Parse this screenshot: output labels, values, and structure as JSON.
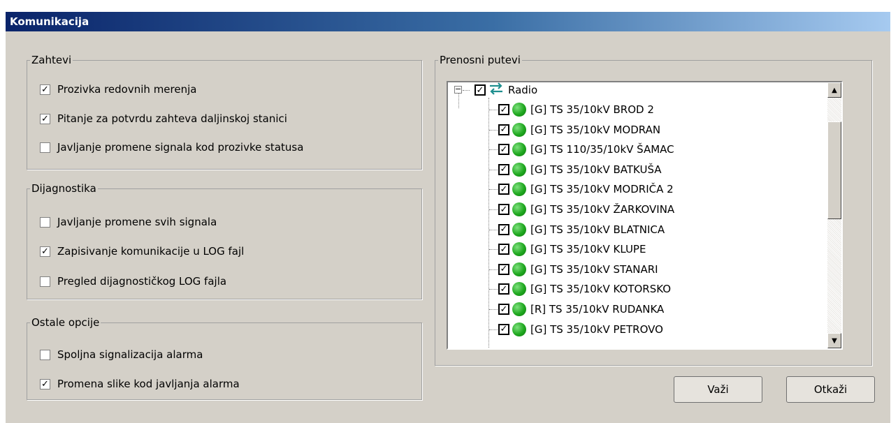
{
  "window": {
    "title": "Komunikacija"
  },
  "groups": {
    "zahtevi": {
      "legend": "Zahtevi",
      "items": [
        {
          "label": "Prozivka redovnih merenja",
          "checked": true
        },
        {
          "label": "Pitanje za potvrdu zahteva daljinskoj stanici",
          "checked": true
        },
        {
          "label": "Javljanje promene signala kod prozivke statusa",
          "checked": false
        }
      ]
    },
    "dijagnostika": {
      "legend": "Dijagnostika",
      "items": [
        {
          "label": "Javljanje promene svih signala",
          "checked": false
        },
        {
          "label": "Zapisivanje komunikacije u LOG fajl",
          "checked": true
        },
        {
          "label": "Pregled dijagnostičkog LOG fajla",
          "checked": false
        }
      ]
    },
    "ostale": {
      "legend": "Ostale opcije",
      "items": [
        {
          "label": "Spoljna signalizacija alarma",
          "checked": false
        },
        {
          "label": "Promena slike kod javljanja alarma",
          "checked": true
        }
      ]
    }
  },
  "prenosni": {
    "legend": "Prenosni putevi",
    "root": {
      "label": "Radio",
      "checked": true,
      "icon": "arrows-exchange-icon"
    },
    "items": [
      {
        "label": "[G] TS 35/10kV BROD 2",
        "checked": true,
        "status_color": "#1fa81f"
      },
      {
        "label": "[G] TS 35/10kV MODRAN",
        "checked": true,
        "status_color": "#1fa81f"
      },
      {
        "label": "[G] TS 110/35/10kV ŠAMAC",
        "checked": true,
        "status_color": "#1fa81f"
      },
      {
        "label": "[G] TS 35/10kV BATKUŠA",
        "checked": true,
        "status_color": "#1fa81f"
      },
      {
        "label": "[G] TS 35/10kV MODRIČA 2",
        "checked": true,
        "status_color": "#1fa81f"
      },
      {
        "label": "[G] TS 35/10kV ŽARKOVINA",
        "checked": true,
        "status_color": "#1fa81f"
      },
      {
        "label": "[G] TS 35/10kV BLATNICA",
        "checked": true,
        "status_color": "#1fa81f"
      },
      {
        "label": "[G] TS 35/10kV KLUPE",
        "checked": true,
        "status_color": "#1fa81f"
      },
      {
        "label": "[G] TS 35/10kV STANARI",
        "checked": true,
        "status_color": "#1fa81f"
      },
      {
        "label": "[G] TS 35/10kV KOTORSKO",
        "checked": true,
        "status_color": "#1fa81f"
      },
      {
        "label": "[R] TS 35/10kV RUDANKA",
        "checked": true,
        "status_color": "#1fa81f"
      },
      {
        "label": "[G] TS 35/10kV PETROVO",
        "checked": true,
        "status_color": "#1fa81f"
      }
    ]
  },
  "buttons": {
    "ok": "Važi",
    "cancel": "Otkaži"
  },
  "colors": {
    "titlebar_start": "#0a246a",
    "titlebar_end": "#a6caf0",
    "dialog_bg": "#d4d0c8"
  }
}
